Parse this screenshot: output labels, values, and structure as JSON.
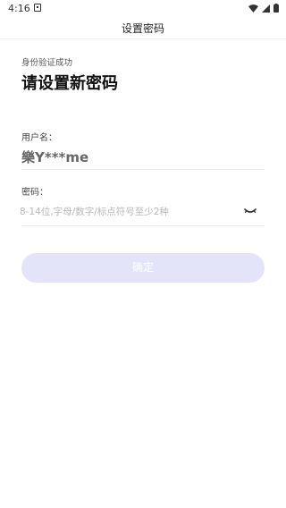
{
  "status_bar": {
    "time": "4:16"
  },
  "nav": {
    "title": "设置密码"
  },
  "form": {
    "verify_hint": "身份验证成功",
    "heading": "请设置新密码",
    "username_label": "用户名：",
    "username_value": "樂Y***me",
    "password_label": "密码：",
    "password_placeholder": "8-14位,字母/数字/标点符号至少2种",
    "password_value": "",
    "confirm_label": "确定",
    "confirm_enabled": false
  },
  "colors": {
    "button_disabled_bg": "#e3e4fa",
    "placeholder": "#b8b8b8"
  }
}
